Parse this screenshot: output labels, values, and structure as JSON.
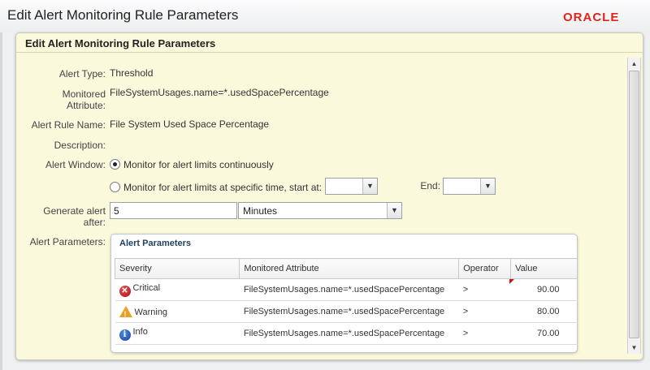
{
  "window": {
    "title": "Edit Alert Monitoring Rule Parameters",
    "logo": "ORACLE",
    "logo_color": "#e2231a"
  },
  "panel": {
    "title": "Edit Alert Monitoring Rule Parameters"
  },
  "form": {
    "alert_type_label": "Alert Type:",
    "alert_type_value": "Threshold",
    "monitored_attr_label_1": "Monitored",
    "monitored_attr_label_2": "Attribute:",
    "monitored_attr_value": "FileSystemUsages.name=*.usedSpacePercentage",
    "rule_name_label": "Alert Rule Name:",
    "rule_name_value": "File System Used Space Percentage",
    "description_label": "Description:",
    "alert_window_label": "Alert Window:",
    "radio_continuous": "Monitor for alert limits continuously",
    "radio_specific": "Monitor for alert limits at specific time, start at:",
    "start_value": "",
    "end_label": "End:",
    "end_value": "",
    "generate_label_1": "Generate alert",
    "generate_label_2": "after:",
    "generate_value": "5",
    "generate_unit": "Minutes",
    "params_label": "Alert Parameters:"
  },
  "params": {
    "title": "Alert Parameters",
    "columns": [
      "Severity",
      "Monitored Attribute",
      "Operator",
      "Value"
    ],
    "rows": [
      {
        "severity": "Critical",
        "icon": "critical-icon",
        "attribute": "FileSystemUsages.name=*.usedSpacePercentage",
        "operator": ">",
        "value": "90.00"
      },
      {
        "severity": "Warning",
        "icon": "warning-icon",
        "attribute": "FileSystemUsages.name=*.usedSpacePercentage",
        "operator": ">",
        "value": "80.00"
      },
      {
        "severity": "Info",
        "icon": "info-icon",
        "attribute": "FileSystemUsages.name=*.usedSpacePercentage",
        "operator": ">",
        "value": "70.00"
      }
    ]
  },
  "colors": {
    "panel_bg": "#fbf9dc",
    "params_title": "#1f3f5e",
    "critical": "#c01818",
    "warning": "#e9a020",
    "info": "#1f56b8"
  }
}
